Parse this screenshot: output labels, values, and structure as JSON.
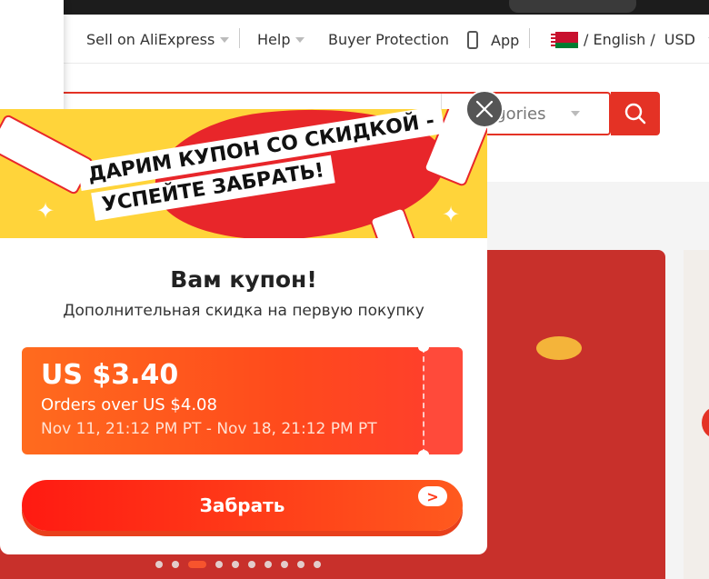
{
  "header": {
    "sell_label": "Sell on AliExpress",
    "help_label": "Help",
    "buyer_protection_label": "Buyer Protection",
    "app_label": "App",
    "language_label": "/ English /",
    "currency_label": "USD"
  },
  "search": {
    "category_label": "ategories"
  },
  "modal": {
    "banner_line1": "ДАРИМ КУПОН СО СКИДКОЙ -",
    "banner_line2": "УСПЕЙТЕ ЗАБРАТЬ!",
    "title": "Вам купон!",
    "subtitle": "Дополнительная скидка на первую покупку",
    "coupon": {
      "amount": "US $3.40",
      "condition": "Orders over US $4.08",
      "period": "Nov 11, 21:12 PM PT - Nov 18, 21:12 PM PT"
    },
    "claim_label": "Забрать",
    "claim_arrow": ">"
  },
  "carousel": {
    "dot_count": 10,
    "active_index": 2
  },
  "colors": {
    "accent": "#e43225",
    "banner_yellow": "#ffd43a",
    "coupon_orange": "#ff6b1e"
  }
}
